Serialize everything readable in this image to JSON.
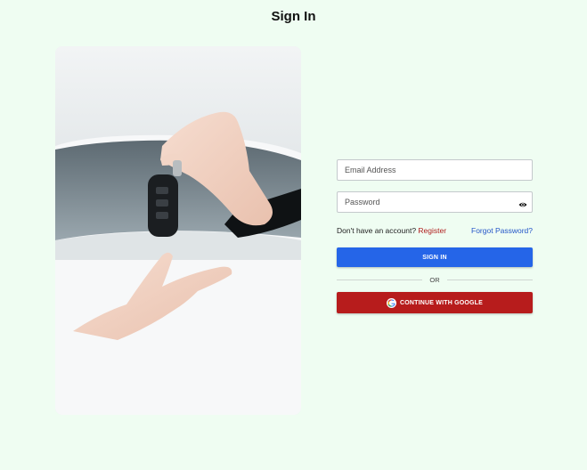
{
  "page": {
    "title": "Sign In"
  },
  "form": {
    "email_placeholder": "Email Address",
    "password_placeholder": "Password",
    "no_account_text": "Don't have an account?",
    "register_label": "Register",
    "forgot_label": "Forgot Password?",
    "signin_label": "SIGN IN",
    "or_label": "OR",
    "google_label": "CONTINUE WITH GOOGLE"
  },
  "colors": {
    "background": "#effdf2",
    "signin_button": "#2565e8",
    "google_button": "#b71c1c",
    "register_link": "#b01e1e",
    "forgot_link": "#2456c8"
  },
  "icons": {
    "password_toggle": "eye-icon",
    "google": "google-icon"
  }
}
